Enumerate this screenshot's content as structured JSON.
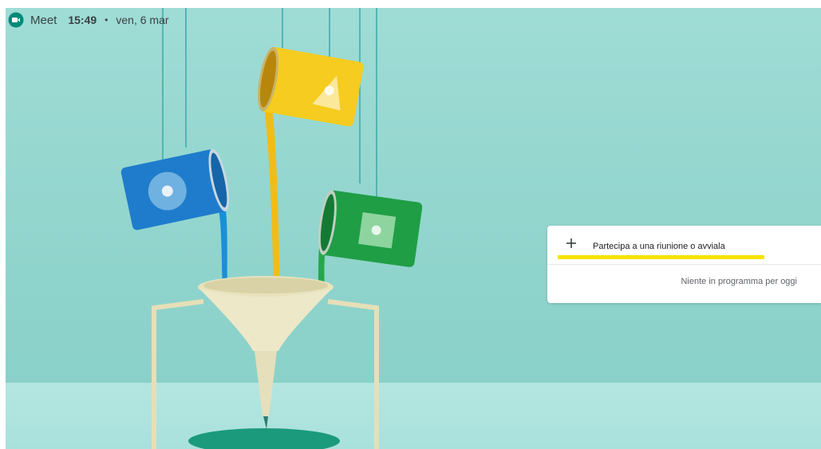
{
  "header": {
    "app_name": "Meet",
    "time": "15:49",
    "separator": "•",
    "date": "ven, 6 mar"
  },
  "meeting_card": {
    "join_label": "Partecipa a una riunione o avviala",
    "empty_schedule": "Niente in programma per oggi",
    "highlight_color": "#f8e300"
  },
  "colors": {
    "background": "#8fd4cc",
    "meet_green": "#00897b",
    "paint_blue": "#1976d2",
    "paint_yellow": "#f2c21b",
    "paint_green": "#1b9b3e"
  },
  "icons": {
    "logo": "meet-logo-icon",
    "add": "plus-icon"
  }
}
